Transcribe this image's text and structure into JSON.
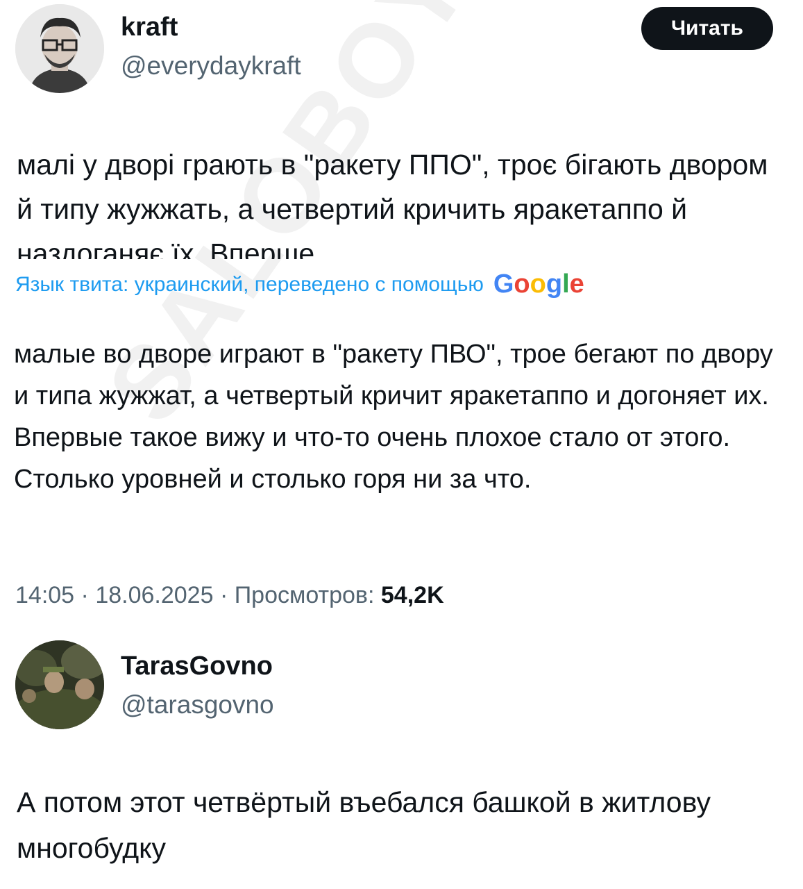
{
  "watermark": "SALOBOY",
  "tweet": {
    "author_name": "kraft",
    "author_handle": "@everydaykraft",
    "follow_label": "Читать",
    "original_text": "малі у дворі грають в \"ракету ППО\", троє бігають двором й типу жужжать, а четвертий кричить яракетаппо й наздоганяє їх. Вперше",
    "translation_label": "Язык твита: украинский, переведено с помощью",
    "translation_provider": "Google",
    "translated_text": "малые во дворе играют в \"ракету ПВО\", трое бегают по двору и типа жужжат, а четвертый кричит яракетаппо и догоняет их. Впервые такое вижу и что-то очень плохое стало от этого. Столько уровней и столько горя ни за что.",
    "time": "14:05",
    "date": "18.06.2025",
    "views_label": "Просмотров:",
    "views_count": "54,2K"
  },
  "reply": {
    "author_name": "TarasGovno",
    "author_handle": "@tarasgovno",
    "text": "А потом этот четвёртый въебался башкой в житлову многобудку"
  }
}
